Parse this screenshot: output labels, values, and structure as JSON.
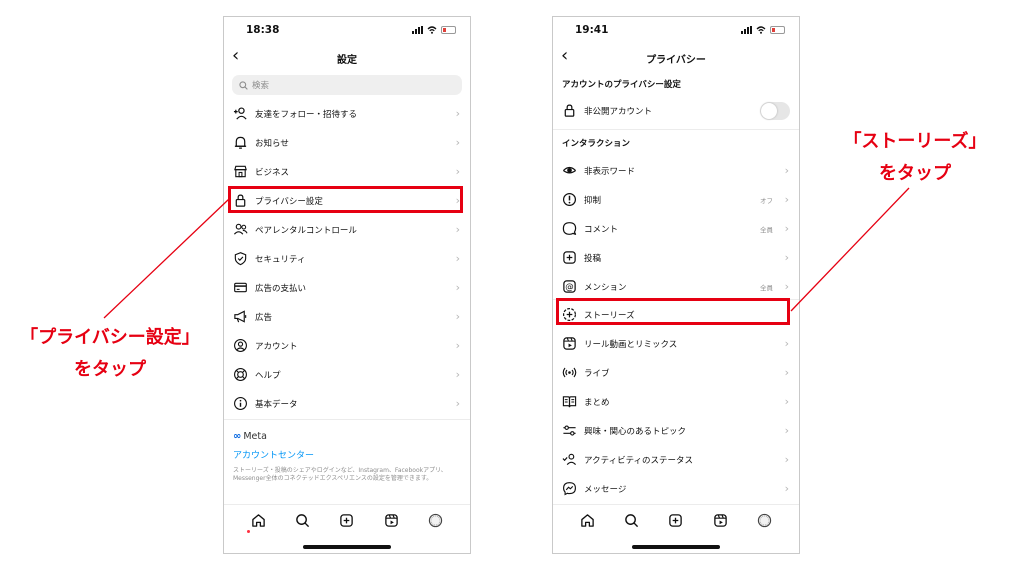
{
  "colors": {
    "accent_red": "#e60012",
    "link_blue": "#0095f6",
    "meta_blue": "#0064e0"
  },
  "left_phone": {
    "time": "18:38",
    "title": "設定",
    "search_placeholder": "検索",
    "items": [
      {
        "label": "友達をフォロー・招待する",
        "icon": "add-person-icon"
      },
      {
        "label": "お知らせ",
        "icon": "bell-icon"
      },
      {
        "label": "ビジネス",
        "icon": "shop-icon"
      },
      {
        "label": "プライバシー設定",
        "icon": "lock-icon"
      },
      {
        "label": "ペアレンタルコントロール",
        "icon": "people-icon"
      },
      {
        "label": "セキュリティ",
        "icon": "shield-check-icon"
      },
      {
        "label": "広告の支払い",
        "icon": "card-icon"
      },
      {
        "label": "広告",
        "icon": "megaphone-icon"
      },
      {
        "label": "アカウント",
        "icon": "account-circle-icon"
      },
      {
        "label": "ヘルプ",
        "icon": "lifebuoy-icon"
      },
      {
        "label": "基本データ",
        "icon": "info-icon"
      }
    ],
    "meta_label": "Meta",
    "accounts_center": "アカウントセンター",
    "accounts_desc": "ストーリーズ・投稿のシェアやログインなど、Instagram、Facebookアプリ、Messenger全体のコネクテッドエクスペリエンスの設定を管理できます。"
  },
  "right_phone": {
    "time": "19:41",
    "title": "プライバシー",
    "section_account": "アカウントのプライバシー設定",
    "private_account": "非公開アカウント",
    "section_interactions": "インタラクション",
    "items": [
      {
        "label": "非表示ワード",
        "value": "",
        "icon": "eye-icon"
      },
      {
        "label": "抑制",
        "value": "オフ",
        "icon": "restrict-icon"
      },
      {
        "label": "コメント",
        "value": "全員",
        "icon": "comment-icon"
      },
      {
        "label": "投稿",
        "value": "",
        "icon": "plus-square-icon"
      },
      {
        "label": "メンション",
        "value": "全員",
        "icon": "at-icon"
      },
      {
        "label": "ストーリーズ",
        "value": "",
        "icon": "story-add-icon"
      },
      {
        "label": "リール動画とリミックス",
        "value": "",
        "icon": "reels-icon"
      },
      {
        "label": "ライブ",
        "value": "",
        "icon": "live-icon"
      },
      {
        "label": "まとめ",
        "value": "",
        "icon": "guide-icon"
      },
      {
        "label": "興味・関心のあるトピック",
        "value": "",
        "icon": "sliders-icon"
      },
      {
        "label": "アクティビティのステータス",
        "value": "",
        "icon": "activity-status-icon"
      },
      {
        "label": "メッセージ",
        "value": "",
        "icon": "messenger-icon"
      }
    ]
  },
  "callouts": {
    "privacy_line1": "「プライバシー設定」",
    "privacy_line2": "をタップ",
    "stories_line1": "「ストーリーズ」",
    "stories_line2": "をタップ"
  }
}
